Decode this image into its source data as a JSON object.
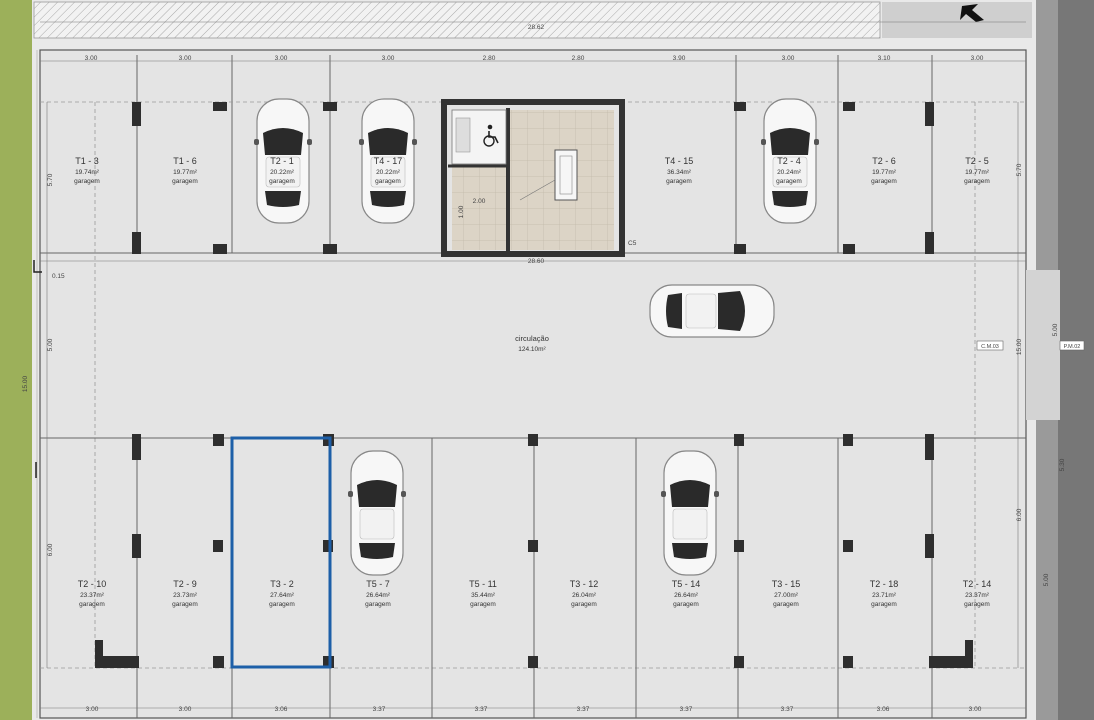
{
  "plan": {
    "top_dimension": "28.62",
    "mid_dimension": "28.60",
    "top_widths": [
      "3.00",
      "3.00",
      "3.00",
      "3.00",
      "2.80",
      "2.80",
      "3.90",
      "3.00",
      "3.10",
      "3.00"
    ],
    "bottom_widths": [
      "3.00",
      "3.00",
      "3.06",
      "3.37",
      "3.37",
      "3.37",
      "3.37",
      "3.37",
      "3.06",
      "3.00"
    ],
    "left_dims": {
      "top_depth": "5.70",
      "gap": "0.15",
      "aisle": "5.00",
      "total": "15.00",
      "bottom_depth": "6.00"
    },
    "right_dims": {
      "top_depth": "5.70",
      "aisle": "15.00",
      "bottom_depth": "6.00",
      "side_a": "5.00",
      "side_b": "5.30",
      "side_c": "5.00"
    },
    "markers": {
      "cm": "C.M.03",
      "pm": "P.M.02"
    },
    "stair": {
      "width_label": "2.00",
      "depth_label": "1.00",
      "code": "C5"
    },
    "circulation": {
      "name": "circulação",
      "area": "124.10m²"
    }
  },
  "top_spots": [
    {
      "id": "T1 - 3",
      "area": "19.74m²",
      "use": "garagem"
    },
    {
      "id": "T1 - 6",
      "area": "19.77m²",
      "use": "garagem"
    },
    {
      "id": "T2 - 1",
      "area": "20.22m²",
      "use": "garagem"
    },
    {
      "id": "T4 - 17",
      "area": "20.22m²",
      "use": "garagem"
    },
    {
      "id": "T4 - 15",
      "area": "36.34m²",
      "use": "garagem"
    },
    {
      "id": "T2 - 4",
      "area": "20.24m²",
      "use": "garagem"
    },
    {
      "id": "T2 - 6",
      "area": "19.77m²",
      "use": "garagem"
    },
    {
      "id": "T2 - 5",
      "area": "19.77m²",
      "use": "garagem"
    }
  ],
  "bottom_spots": [
    {
      "id": "T2 - 10",
      "area": "23.37m²",
      "use": "garagem"
    },
    {
      "id": "T2 - 9",
      "area": "23.73m²",
      "use": "garagem"
    },
    {
      "id": "T3 - 2",
      "area": "27.64m²",
      "use": "garagem"
    },
    {
      "id": "T5 - 7",
      "area": "26.64m²",
      "use": "garagem"
    },
    {
      "id": "T5 - 11",
      "area": "35.44m²",
      "use": "garagem"
    },
    {
      "id": "T3 - 12",
      "area": "26.04m²",
      "use": "garagem"
    },
    {
      "id": "T5 - 14",
      "area": "26.64m²",
      "use": "garagem"
    },
    {
      "id": "T3 - 15",
      "area": "27.00m²",
      "use": "garagem"
    },
    {
      "id": "T2 - 18",
      "area": "23.71m²",
      "use": "garagem"
    },
    {
      "id": "T2 - 14",
      "area": "23.37m²",
      "use": "garagem"
    }
  ],
  "colors": {
    "highlight": "#1d5fa8",
    "floor": "#e4e4e4",
    "grass": "#9cb05a",
    "road": "#777777"
  }
}
